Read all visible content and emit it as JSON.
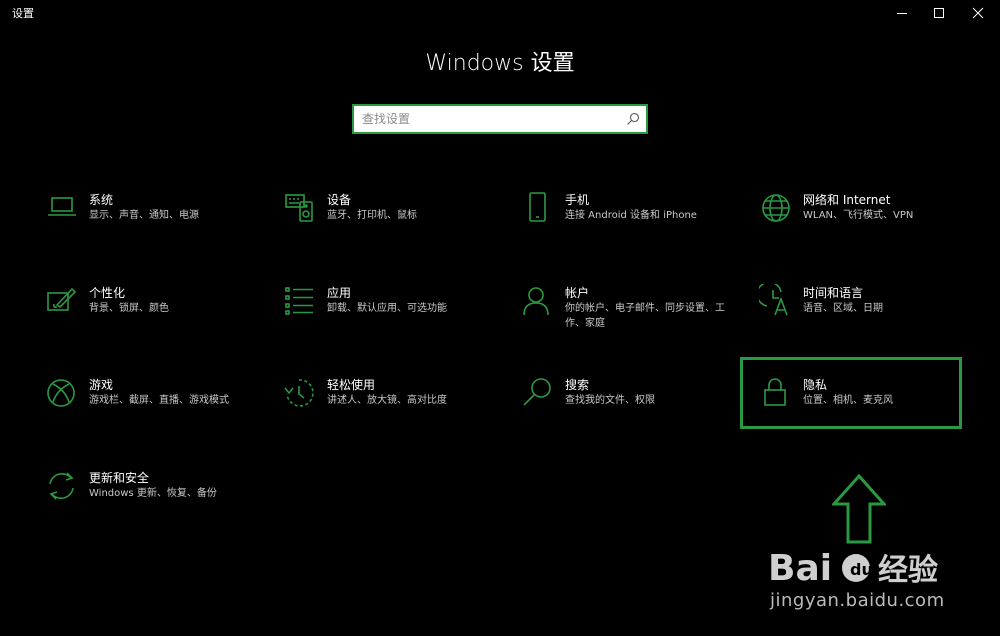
{
  "window": {
    "title": "设置",
    "controls": [
      "minimize-icon",
      "maximize-icon",
      "close-icon"
    ]
  },
  "header": {
    "title": "Windows 设置"
  },
  "search": {
    "placeholder": "查找设置",
    "value": ""
  },
  "accent_color": "#2a9a42",
  "tiles": [
    {
      "title": "系统",
      "desc": "显示、声音、通知、电源",
      "icon": "laptop-icon"
    },
    {
      "title": "设备",
      "desc": "蓝牙、打印机、鼠标",
      "icon": "devices-icon"
    },
    {
      "title": "手机",
      "desc": "连接 Android 设备和 iPhone",
      "icon": "phone-icon"
    },
    {
      "title": "网络和 Internet",
      "desc": "WLAN、飞行模式、VPN",
      "icon": "globe-icon"
    },
    {
      "title": "个性化",
      "desc": "背景、锁屏、颜色",
      "icon": "personalize-icon"
    },
    {
      "title": "应用",
      "desc": "卸载、默认应用、可选功能",
      "icon": "apps-list-icon"
    },
    {
      "title": "帐户",
      "desc": "你的帐户、电子邮件、同步设置、工作、家庭",
      "icon": "person-icon"
    },
    {
      "title": "时间和语言",
      "desc": "语音、区域、日期",
      "icon": "time-language-icon"
    },
    {
      "title": "游戏",
      "desc": "游戏栏、截屏、直播、游戏模式",
      "icon": "xbox-icon"
    },
    {
      "title": "轻松使用",
      "desc": "讲述人、放大镜、高对比度",
      "icon": "ease-of-access-icon"
    },
    {
      "title": "搜索",
      "desc": "查找我的文件、权限",
      "icon": "search-icon"
    },
    {
      "title": "隐私",
      "desc": "位置、相机、麦克风",
      "icon": "lock-icon"
    },
    {
      "title": "更新和安全",
      "desc": "Windows 更新、恢复、备份",
      "icon": "sync-icon"
    }
  ],
  "annotation": {
    "highlight_color": "#2a9a42",
    "arrow_icon": "up-arrow-icon"
  },
  "watermark": {
    "logo_text": "Bai 经验",
    "url": "jingyan.baidu.com"
  }
}
